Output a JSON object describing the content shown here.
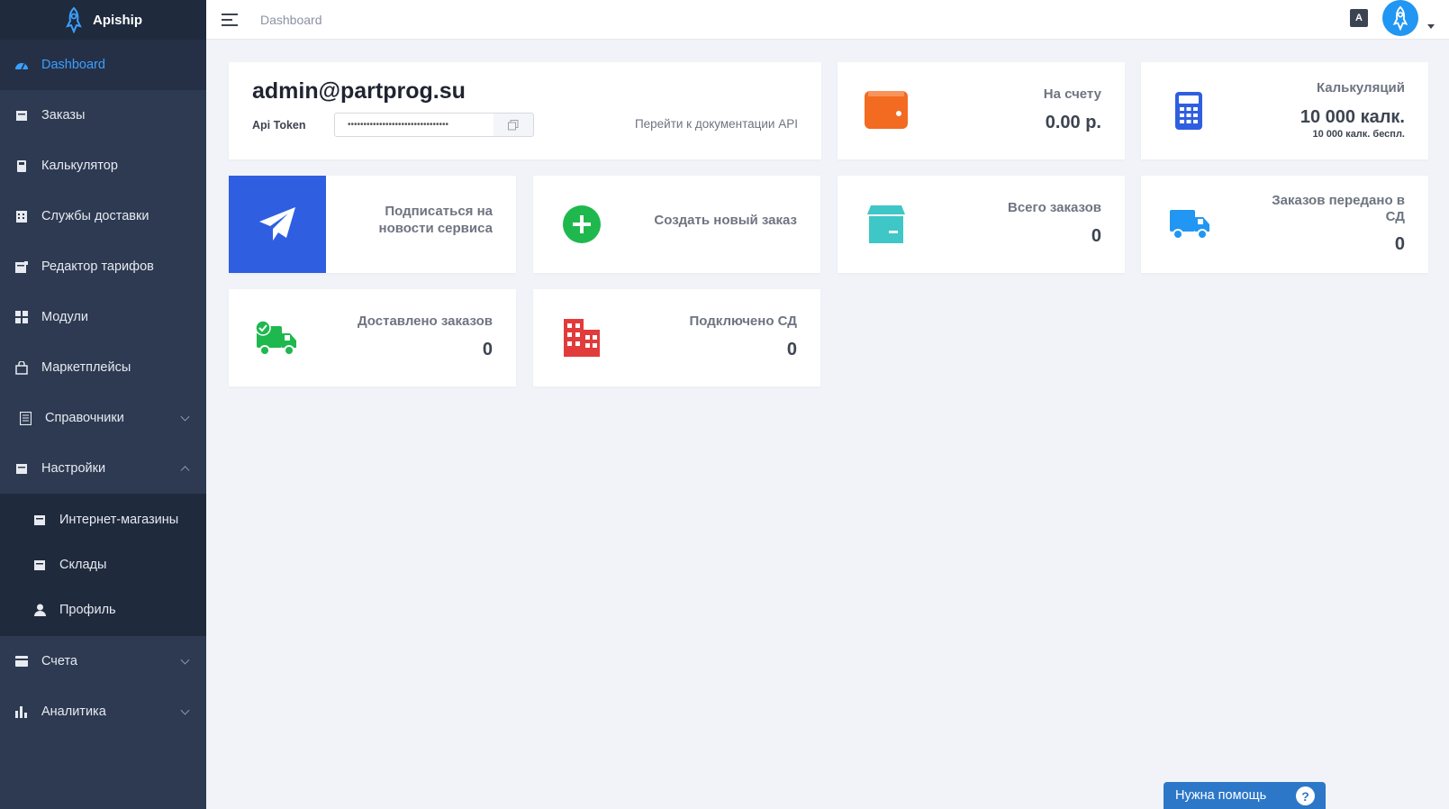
{
  "brand": {
    "name": "Apiship"
  },
  "sidebar": {
    "items": [
      {
        "label": "Dashboard",
        "icon": "dashboard-icon",
        "active": true
      },
      {
        "label": "Заказы",
        "icon": "orders-icon"
      },
      {
        "label": "Калькулятор",
        "icon": "calculator-icon"
      },
      {
        "label": "Службы доставки",
        "icon": "delivery-services-icon"
      },
      {
        "label": "Редактор тарифов",
        "icon": "tariff-editor-icon"
      },
      {
        "label": "Модули",
        "icon": "modules-icon"
      },
      {
        "label": "Маркетплейсы",
        "icon": "shopping-bag-icon"
      },
      {
        "label": "Справочники",
        "icon": "book-icon",
        "expandable": true
      },
      {
        "label": "Настройки",
        "icon": "settings-icon",
        "expandable": true,
        "expanded": true
      },
      {
        "label": "Счета",
        "icon": "bills-icon",
        "expandable": true
      },
      {
        "label": "Аналитика",
        "icon": "analytics-icon",
        "expandable": true
      }
    ],
    "settings_sub": [
      {
        "label": "Интернет-магазины",
        "icon": "store-icon"
      },
      {
        "label": "Склады",
        "icon": "warehouse-icon"
      },
      {
        "label": "Профиль",
        "icon": "user-icon"
      }
    ]
  },
  "header": {
    "breadcrumb": "Dashboard"
  },
  "account": {
    "email": "admin@partprog.su",
    "token_label": "Api Token",
    "token_masked": "••••••••••••••••••••••••••••••••",
    "docs_link": "Перейти к документации API"
  },
  "balance": {
    "label": "На счету",
    "value": "0.00 р."
  },
  "calculations": {
    "label": "Калькуляций",
    "value": "10 000 калк.",
    "sub": "10 000 калк. беспл."
  },
  "subscribe": {
    "label": "Подписаться на новости сервиса"
  },
  "new_order": {
    "label": "Создать новый заказ"
  },
  "total_orders": {
    "label": "Всего заказов",
    "value": "0"
  },
  "orders_transferred": {
    "label": "Заказов передано в СД",
    "value": "0"
  },
  "delivered": {
    "label": "Доставлено заказов",
    "value": "0"
  },
  "connected": {
    "label": "Подключено СД",
    "value": "0"
  },
  "help": {
    "label": "Нужна помощь",
    "q": "?"
  },
  "colors": {
    "sidebar_bg": "#2d3a52",
    "accent": "#3ba0ff",
    "orange": "#f26b21",
    "blue": "#2f5fe0",
    "green": "#1fb84e",
    "teal": "#3ec7c6",
    "red": "#e23b3b",
    "help": "#2c77c8"
  }
}
